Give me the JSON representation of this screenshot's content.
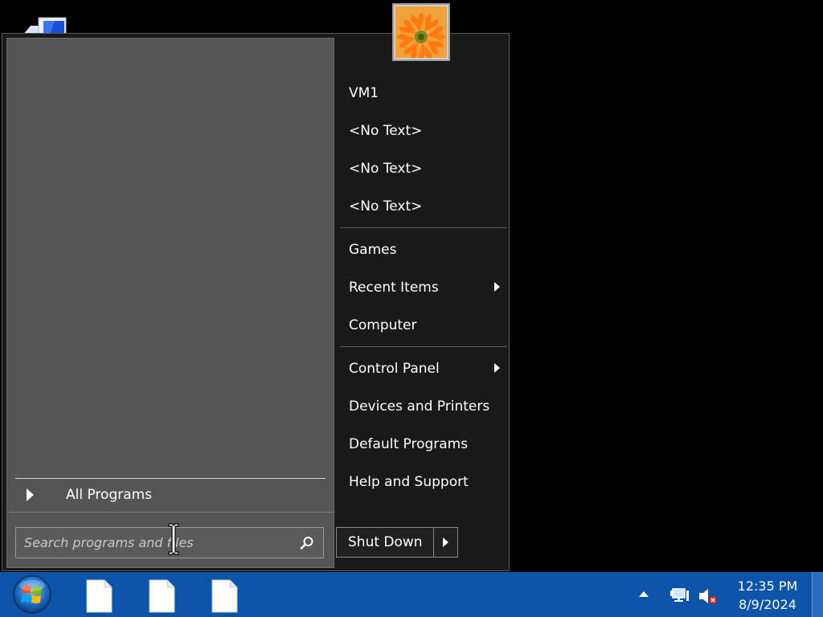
{
  "start_menu": {
    "all_programs_label": "All Programs",
    "search": {
      "placeholder": "Search programs and files",
      "value": ""
    },
    "right_items": [
      {
        "label": "VM1",
        "has_arrow": false
      },
      {
        "label": "<No Text>",
        "has_arrow": false
      },
      {
        "label": "<No Text>",
        "has_arrow": false
      },
      {
        "label": "<No Text>",
        "has_arrow": false
      },
      {
        "label": "Games",
        "has_arrow": false
      },
      {
        "label": "Recent Items",
        "has_arrow": true
      },
      {
        "label": "Computer",
        "has_arrow": false
      },
      {
        "label": "Control Panel",
        "has_arrow": true
      },
      {
        "label": "Devices and Printers",
        "has_arrow": false
      },
      {
        "label": "Default Programs",
        "has_arrow": false
      },
      {
        "label": "Help and Support",
        "has_arrow": false
      }
    ],
    "shutdown_label": "Shut Down"
  },
  "taskbar": {
    "clock": {
      "time": "12:35 PM",
      "date": "8/9/2024"
    },
    "pinned": [
      "file-icon",
      "file-icon",
      "file-icon"
    ]
  },
  "colors": {
    "taskbar": "#0b54a9",
    "menu_bg": "#191919",
    "left_pane": "#555555"
  }
}
